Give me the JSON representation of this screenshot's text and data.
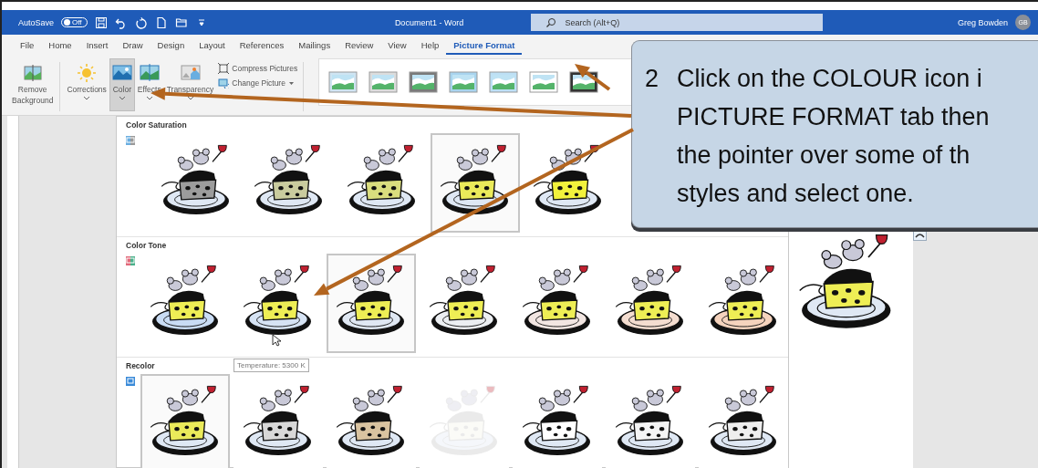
{
  "title_bar": {
    "autosave_label": "AutoSave",
    "autosave_toggle": "Off",
    "autosave_on": false,
    "document_title": "Document1  -  Word",
    "search": {
      "placeholder": "Search (Alt+Q)"
    },
    "user_name": "Greg Bowden",
    "user_initials": "GB"
  },
  "tabs": [
    {
      "label": "File",
      "selected": false
    },
    {
      "label": "Home",
      "selected": false
    },
    {
      "label": "Insert",
      "selected": false
    },
    {
      "label": "Draw",
      "selected": false
    },
    {
      "label": "Design",
      "selected": false
    },
    {
      "label": "Layout",
      "selected": false
    },
    {
      "label": "References",
      "selected": false
    },
    {
      "label": "Mailings",
      "selected": false
    },
    {
      "label": "Review",
      "selected": false
    },
    {
      "label": "View",
      "selected": false
    },
    {
      "label": "Help",
      "selected": false
    },
    {
      "label": "Picture Format",
      "selected": true
    }
  ],
  "ribbon": {
    "large_buttons": [
      {
        "kind": "remove",
        "label": "Remove\nBackground",
        "selected": false,
        "caret": false
      },
      {
        "kind": "sun",
        "label": "Corrections",
        "selected": false,
        "caret": true
      },
      {
        "kind": "picture",
        "label": "Color",
        "selected": true,
        "caret": true
      },
      {
        "kind": "effects",
        "label": "Effects",
        "selected": false,
        "caret": true
      },
      {
        "kind": "transparency",
        "label": "Transparency",
        "selected": false,
        "caret": true
      }
    ],
    "small_buttons": [
      {
        "label": "Compress Pictures",
        "caret": false
      },
      {
        "label": "Change Picture",
        "caret": true
      }
    ]
  },
  "gallery": {
    "sections": [
      {
        "title": "Color Saturation",
        "items": [
          {
            "color": "#9c9c9c",
            "selected": false
          },
          {
            "color": "#c9cb9e",
            "selected": false
          },
          {
            "color": "#dadd7e",
            "selected": false
          },
          {
            "color": "#eaea5a",
            "selected": true
          },
          {
            "color": "#f2f23c",
            "selected": false
          }
        ]
      },
      {
        "title": "Color Tone",
        "items": [
          {
            "color": "#c9dcf4",
            "selected": false
          },
          {
            "color": "#d6e3f4",
            "selected": false
          },
          {
            "color": "#e0e8f3",
            "selected": true
          },
          {
            "color": "#eceff2",
            "selected": false
          },
          {
            "color": "#f2e6e2",
            "selected": false
          },
          {
            "color": "#f4ddd0",
            "selected": false
          },
          {
            "color": "#f5d3bd",
            "selected": false
          }
        ]
      },
      {
        "title": "Recolor",
        "items": [
          {
            "color": "#eaea5a",
            "selected": true
          },
          {
            "color": "#d8d8d8",
            "selected": false
          },
          {
            "color": "#d9c3a0",
            "selected": false
          },
          {
            "color": "#f2f2e6",
            "selected": false
          },
          {
            "color": "#ffffff",
            "selected": false
          },
          {
            "color": "#f4f4f4",
            "selected": false
          },
          {
            "color": "#eeeeee",
            "selected": false
          }
        ]
      }
    ],
    "tooltip": "Temperature: 5300 K"
  },
  "callout": {
    "number": "2",
    "lines": [
      "Click on the COLOUR icon i",
      "PICTURE FORMAT tab then",
      "the pointer over some of th",
      "styles and select one."
    ]
  }
}
